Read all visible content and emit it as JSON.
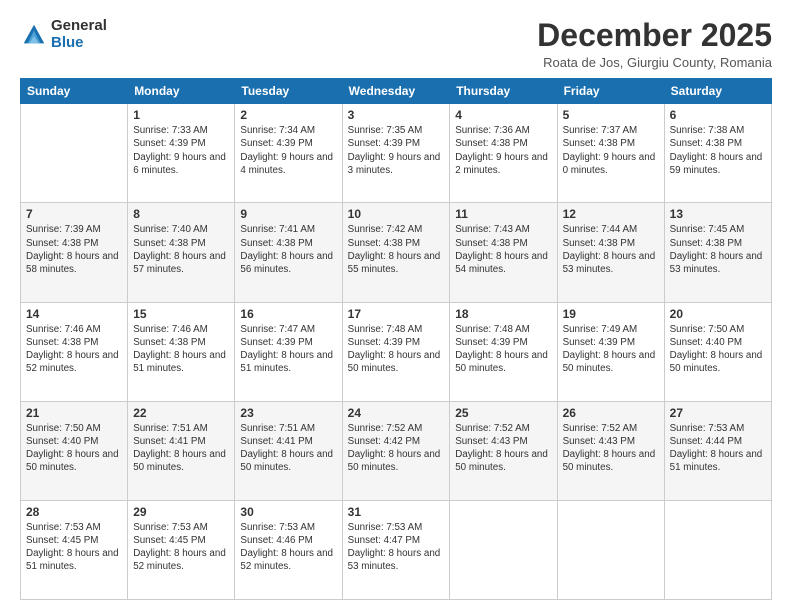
{
  "logo": {
    "general": "General",
    "blue": "Blue"
  },
  "title": "December 2025",
  "location": "Roata de Jos, Giurgiu County, Romania",
  "days_of_week": [
    "Sunday",
    "Monday",
    "Tuesday",
    "Wednesday",
    "Thursday",
    "Friday",
    "Saturday"
  ],
  "weeks": [
    [
      {
        "day": "",
        "sunrise": "",
        "sunset": "",
        "daylight": ""
      },
      {
        "day": "1",
        "sunrise": "Sunrise: 7:33 AM",
        "sunset": "Sunset: 4:39 PM",
        "daylight": "Daylight: 9 hours and 6 minutes."
      },
      {
        "day": "2",
        "sunrise": "Sunrise: 7:34 AM",
        "sunset": "Sunset: 4:39 PM",
        "daylight": "Daylight: 9 hours and 4 minutes."
      },
      {
        "day": "3",
        "sunrise": "Sunrise: 7:35 AM",
        "sunset": "Sunset: 4:39 PM",
        "daylight": "Daylight: 9 hours and 3 minutes."
      },
      {
        "day": "4",
        "sunrise": "Sunrise: 7:36 AM",
        "sunset": "Sunset: 4:38 PM",
        "daylight": "Daylight: 9 hours and 2 minutes."
      },
      {
        "day": "5",
        "sunrise": "Sunrise: 7:37 AM",
        "sunset": "Sunset: 4:38 PM",
        "daylight": "Daylight: 9 hours and 0 minutes."
      },
      {
        "day": "6",
        "sunrise": "Sunrise: 7:38 AM",
        "sunset": "Sunset: 4:38 PM",
        "daylight": "Daylight: 8 hours and 59 minutes."
      }
    ],
    [
      {
        "day": "7",
        "sunrise": "Sunrise: 7:39 AM",
        "sunset": "Sunset: 4:38 PM",
        "daylight": "Daylight: 8 hours and 58 minutes."
      },
      {
        "day": "8",
        "sunrise": "Sunrise: 7:40 AM",
        "sunset": "Sunset: 4:38 PM",
        "daylight": "Daylight: 8 hours and 57 minutes."
      },
      {
        "day": "9",
        "sunrise": "Sunrise: 7:41 AM",
        "sunset": "Sunset: 4:38 PM",
        "daylight": "Daylight: 8 hours and 56 minutes."
      },
      {
        "day": "10",
        "sunrise": "Sunrise: 7:42 AM",
        "sunset": "Sunset: 4:38 PM",
        "daylight": "Daylight: 8 hours and 55 minutes."
      },
      {
        "day": "11",
        "sunrise": "Sunrise: 7:43 AM",
        "sunset": "Sunset: 4:38 PM",
        "daylight": "Daylight: 8 hours and 54 minutes."
      },
      {
        "day": "12",
        "sunrise": "Sunrise: 7:44 AM",
        "sunset": "Sunset: 4:38 PM",
        "daylight": "Daylight: 8 hours and 53 minutes."
      },
      {
        "day": "13",
        "sunrise": "Sunrise: 7:45 AM",
        "sunset": "Sunset: 4:38 PM",
        "daylight": "Daylight: 8 hours and 53 minutes."
      }
    ],
    [
      {
        "day": "14",
        "sunrise": "Sunrise: 7:46 AM",
        "sunset": "Sunset: 4:38 PM",
        "daylight": "Daylight: 8 hours and 52 minutes."
      },
      {
        "day": "15",
        "sunrise": "Sunrise: 7:46 AM",
        "sunset": "Sunset: 4:38 PM",
        "daylight": "Daylight: 8 hours and 51 minutes."
      },
      {
        "day": "16",
        "sunrise": "Sunrise: 7:47 AM",
        "sunset": "Sunset: 4:39 PM",
        "daylight": "Daylight: 8 hours and 51 minutes."
      },
      {
        "day": "17",
        "sunrise": "Sunrise: 7:48 AM",
        "sunset": "Sunset: 4:39 PM",
        "daylight": "Daylight: 8 hours and 50 minutes."
      },
      {
        "day": "18",
        "sunrise": "Sunrise: 7:48 AM",
        "sunset": "Sunset: 4:39 PM",
        "daylight": "Daylight: 8 hours and 50 minutes."
      },
      {
        "day": "19",
        "sunrise": "Sunrise: 7:49 AM",
        "sunset": "Sunset: 4:39 PM",
        "daylight": "Daylight: 8 hours and 50 minutes."
      },
      {
        "day": "20",
        "sunrise": "Sunrise: 7:50 AM",
        "sunset": "Sunset: 4:40 PM",
        "daylight": "Daylight: 8 hours and 50 minutes."
      }
    ],
    [
      {
        "day": "21",
        "sunrise": "Sunrise: 7:50 AM",
        "sunset": "Sunset: 4:40 PM",
        "daylight": "Daylight: 8 hours and 50 minutes."
      },
      {
        "day": "22",
        "sunrise": "Sunrise: 7:51 AM",
        "sunset": "Sunset: 4:41 PM",
        "daylight": "Daylight: 8 hours and 50 minutes."
      },
      {
        "day": "23",
        "sunrise": "Sunrise: 7:51 AM",
        "sunset": "Sunset: 4:41 PM",
        "daylight": "Daylight: 8 hours and 50 minutes."
      },
      {
        "day": "24",
        "sunrise": "Sunrise: 7:52 AM",
        "sunset": "Sunset: 4:42 PM",
        "daylight": "Daylight: 8 hours and 50 minutes."
      },
      {
        "day": "25",
        "sunrise": "Sunrise: 7:52 AM",
        "sunset": "Sunset: 4:43 PM",
        "daylight": "Daylight: 8 hours and 50 minutes."
      },
      {
        "day": "26",
        "sunrise": "Sunrise: 7:52 AM",
        "sunset": "Sunset: 4:43 PM",
        "daylight": "Daylight: 8 hours and 50 minutes."
      },
      {
        "day": "27",
        "sunrise": "Sunrise: 7:53 AM",
        "sunset": "Sunset: 4:44 PM",
        "daylight": "Daylight: 8 hours and 51 minutes."
      }
    ],
    [
      {
        "day": "28",
        "sunrise": "Sunrise: 7:53 AM",
        "sunset": "Sunset: 4:45 PM",
        "daylight": "Daylight: 8 hours and 51 minutes."
      },
      {
        "day": "29",
        "sunrise": "Sunrise: 7:53 AM",
        "sunset": "Sunset: 4:45 PM",
        "daylight": "Daylight: 8 hours and 52 minutes."
      },
      {
        "day": "30",
        "sunrise": "Sunrise: 7:53 AM",
        "sunset": "Sunset: 4:46 PM",
        "daylight": "Daylight: 8 hours and 52 minutes."
      },
      {
        "day": "31",
        "sunrise": "Sunrise: 7:53 AM",
        "sunset": "Sunset: 4:47 PM",
        "daylight": "Daylight: 8 hours and 53 minutes."
      },
      {
        "day": "",
        "sunrise": "",
        "sunset": "",
        "daylight": ""
      },
      {
        "day": "",
        "sunrise": "",
        "sunset": "",
        "daylight": ""
      },
      {
        "day": "",
        "sunrise": "",
        "sunset": "",
        "daylight": ""
      }
    ]
  ]
}
